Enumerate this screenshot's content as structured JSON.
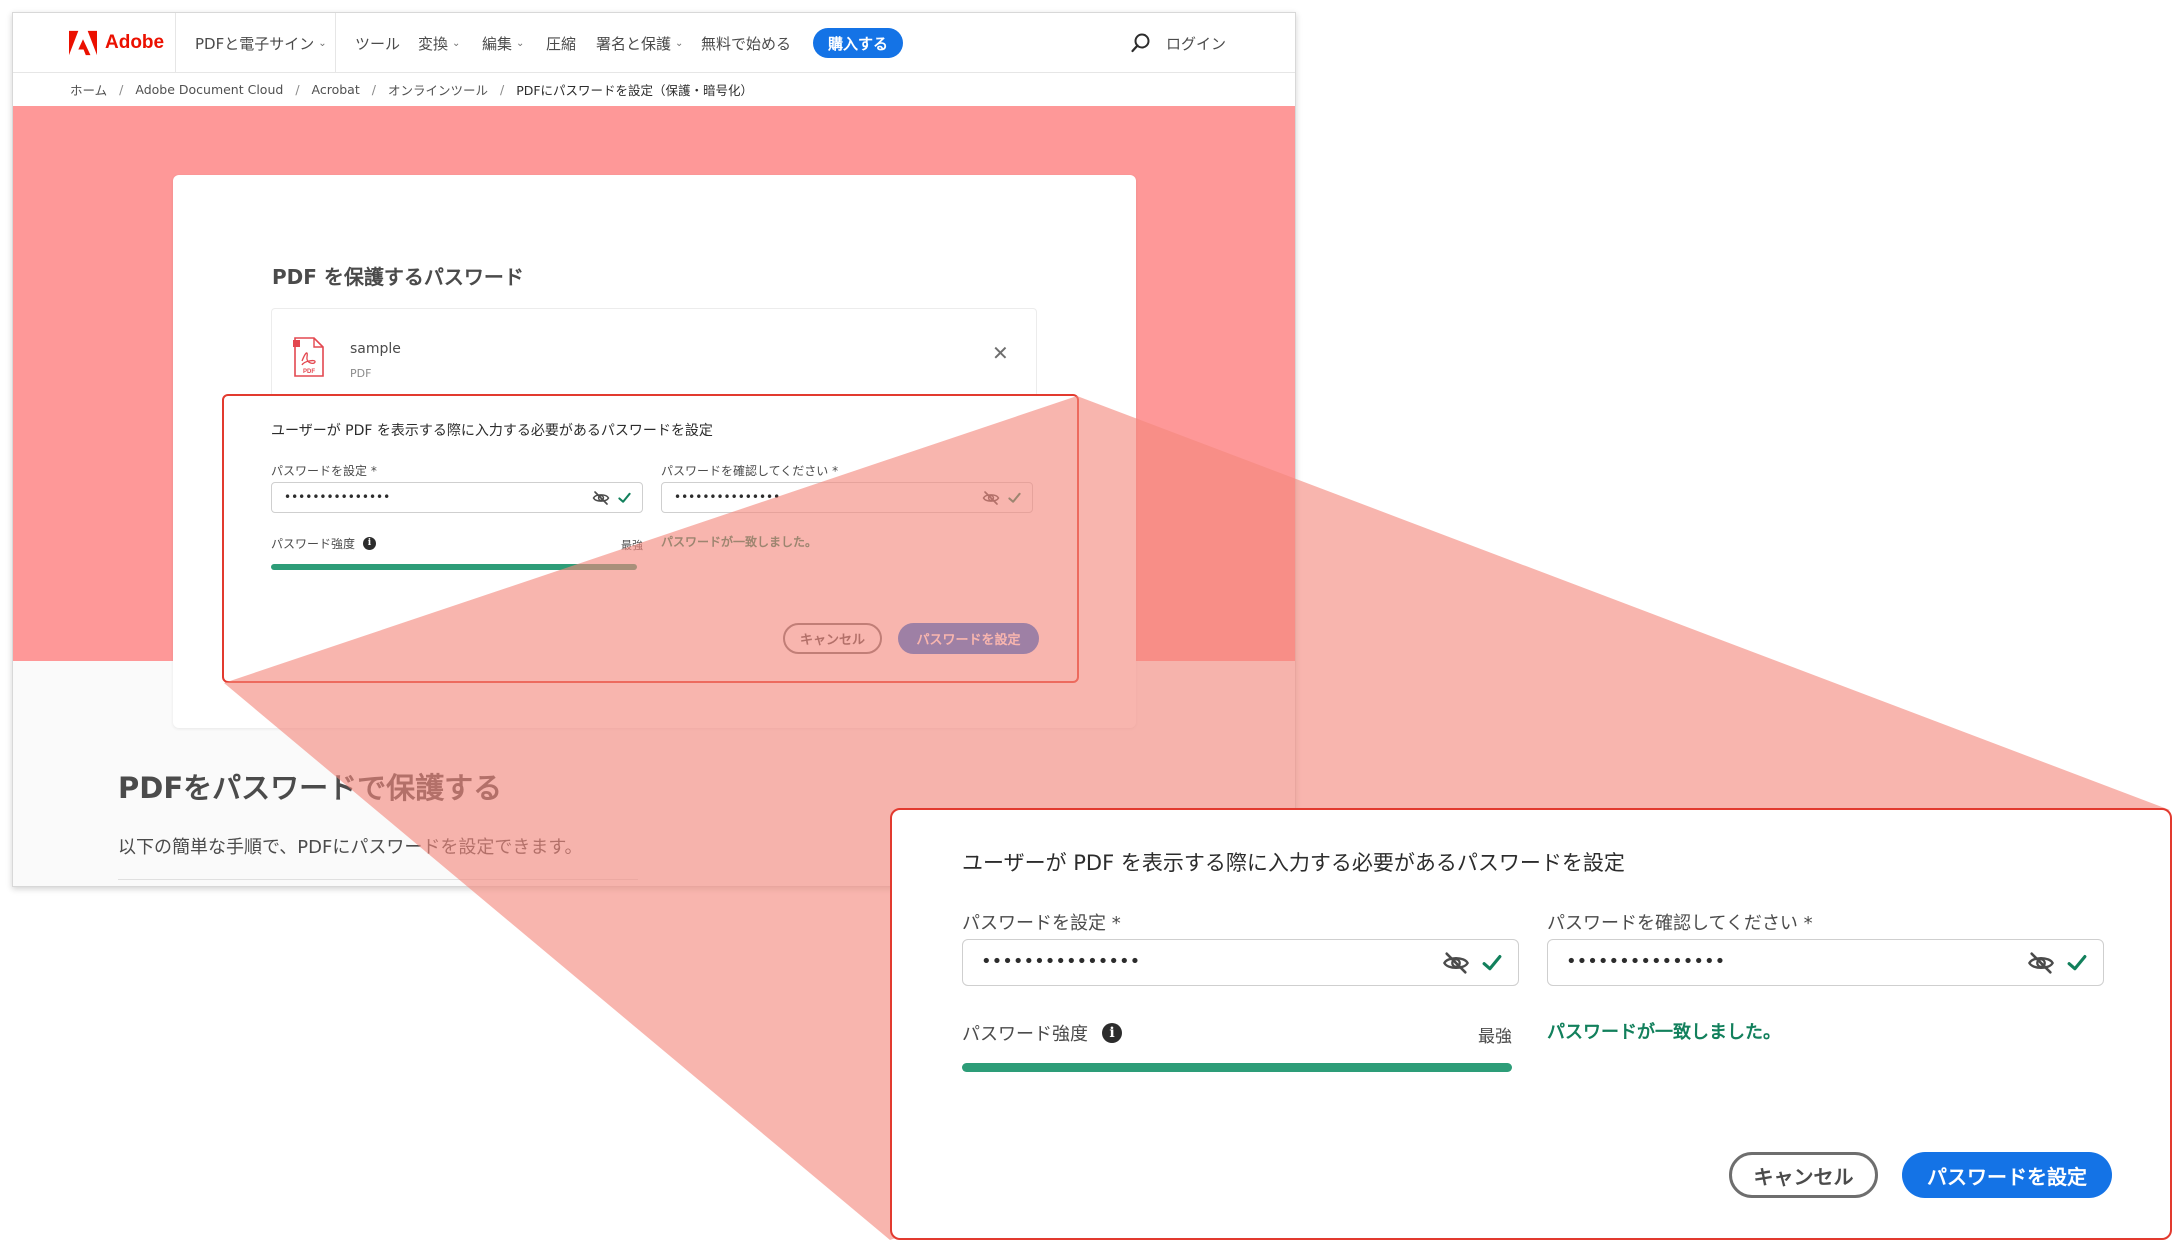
{
  "nav": {
    "logo_text": "Adobe",
    "items": [
      "PDFと電子サイン",
      "ツール",
      "変換",
      "編集",
      "圧縮",
      "署名と保護",
      "無料で始める"
    ],
    "buy_label": "購入する",
    "login_label": "ログイン"
  },
  "breadcrumb": [
    "ホーム",
    "Adobe Document Cloud",
    "Acrobat",
    "オンラインツール",
    "PDFにパスワードを設定（保護・暗号化）"
  ],
  "card": {
    "title": "PDF を保護するパスワード",
    "file_name": "sample",
    "file_type": "PDF",
    "close_glyph": "✕"
  },
  "dialog": {
    "heading": "ユーザーが PDF を表示する際に入力する必要があるパスワードを設定",
    "set_label": "パスワードを設定 *",
    "confirm_label": "パスワードを確認してください *",
    "password_mask": "•••••••••••••••",
    "confirm_mask": "•••••••••••••••",
    "strength_label": "パスワード強度",
    "strength_value": "最強",
    "strength_fraction": 1.0,
    "info_glyph": "i",
    "match_message": "パスワードが一致しました。",
    "cancel_label": "キャンセル",
    "submit_label": "パスワードを設定"
  },
  "section": {
    "heading": "PDFをパスワードで保護する",
    "subtext": "以下の簡単な手順で、PDFにパスワードを設定できます。"
  },
  "colors": {
    "hero_bg": "#fe9898",
    "accent_blue": "#1473e6",
    "adobe_red": "#eb1000",
    "strength_green": "#2d9d78",
    "success_text": "#12805c",
    "highlight_border": "#e23a2f",
    "zoom_overlay": "#f4877c"
  },
  "icons": [
    "adobe-logo-icon",
    "chevron-down-icon",
    "search-icon",
    "pdf-file-icon",
    "close-icon",
    "eye-off-icon",
    "check-icon",
    "info-icon"
  ]
}
